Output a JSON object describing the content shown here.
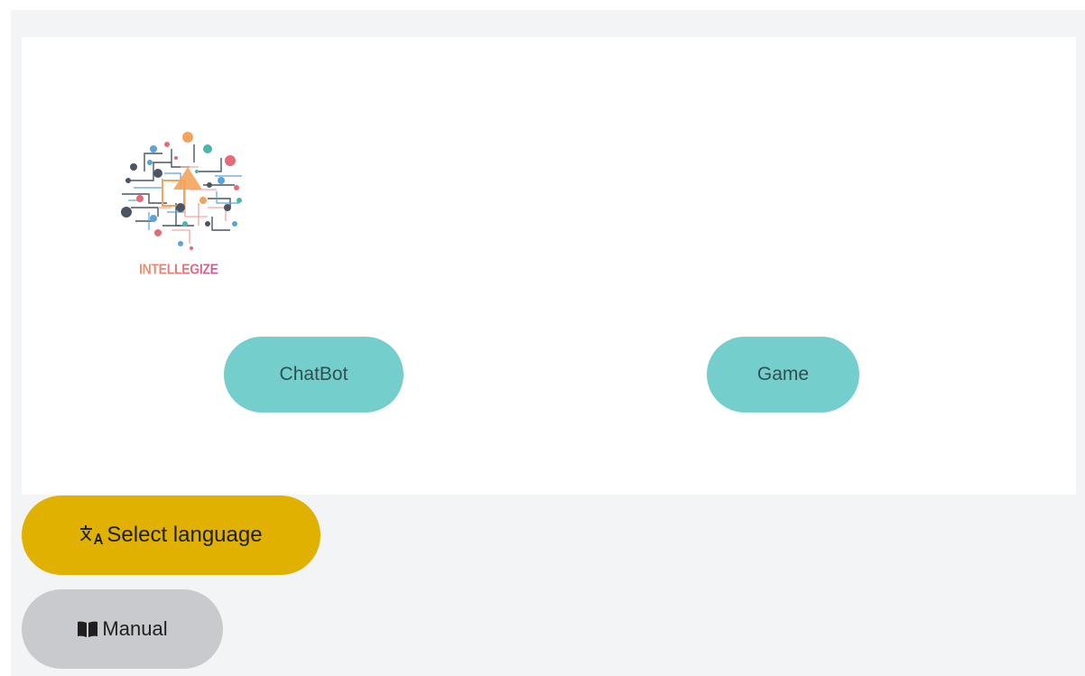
{
  "logo": {
    "text": "INTELLEGIZE",
    "icon": "brain-circuit-logo"
  },
  "main": {
    "chatbot_label": "ChatBot",
    "game_label": "Game"
  },
  "footer": {
    "language_label": "Select language",
    "language_icon": "translate-icon",
    "manual_label": "Manual",
    "manual_icon": "book-open-icon"
  },
  "colors": {
    "page_background": "#f3f4f6",
    "card_background": "#ffffff",
    "teal_button": "#74cfcc",
    "language_button": "#e0b100",
    "manual_button": "#c9cace"
  }
}
